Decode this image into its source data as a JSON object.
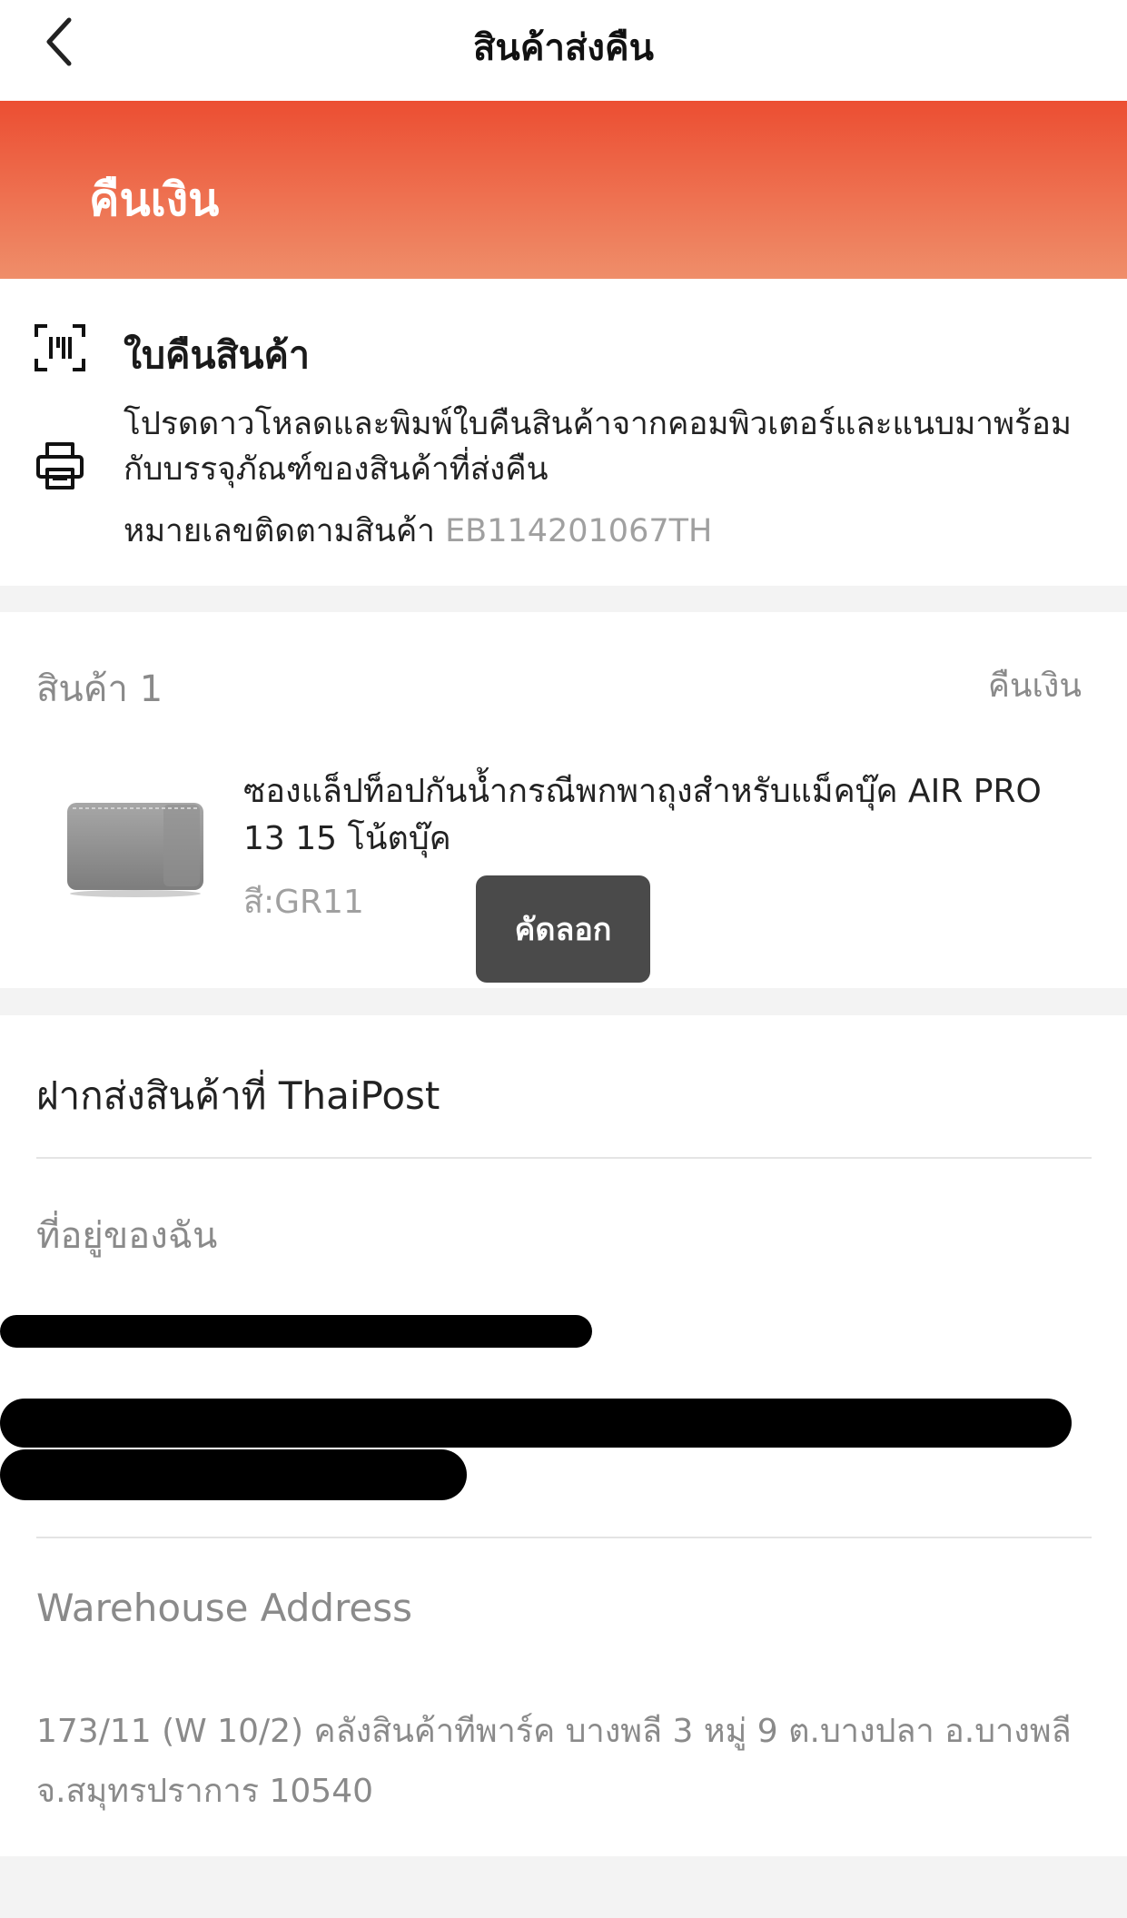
{
  "header": {
    "title": "สินค้าส่งคืน",
    "back_icon": "chevron-left-icon"
  },
  "banner": {
    "title": "คืนเงิน",
    "gradient_start": "#ec4e32",
    "gradient_end": "#ef8e6a"
  },
  "return_slip": {
    "title": "ใบคืนสินค้า",
    "description": "โปรดดาวโหลดและพิมพ์ใบคืนสินค้าจากคอมพิวเตอร์และแนบมาพร้อมกับบรรจุภัณฑ์ของสินค้าที่ส่งคืน",
    "tracking_label": "หมายเลขติดตามสินค้า",
    "tracking_number": "EB114201067TH"
  },
  "product": {
    "header": "สินค้า 1",
    "status": "คืนเงิน",
    "name": "ซองแล็ปท็อปกันน้ำกรณีพกพาถุงสำหรับแม็คบุ๊ค AIR PRO 13 15 โน้ตบุ๊ค",
    "variant": "สี:GR11"
  },
  "toast": {
    "label": "คัดลอก"
  },
  "dropoff": {
    "title": "ฝากส่งสินค้าที่ ThaiPost",
    "my_address_label": "ที่อยู่ของฉัน",
    "warehouse_label": "Warehouse Address",
    "warehouse_address": "173/11 (W 10/2) คลังสินค้าทีพาร์ค บางพลี 3 หมู่ 9 ต.บางปลา อ.บางพลี จ.สมุทรปราการ 10540"
  }
}
